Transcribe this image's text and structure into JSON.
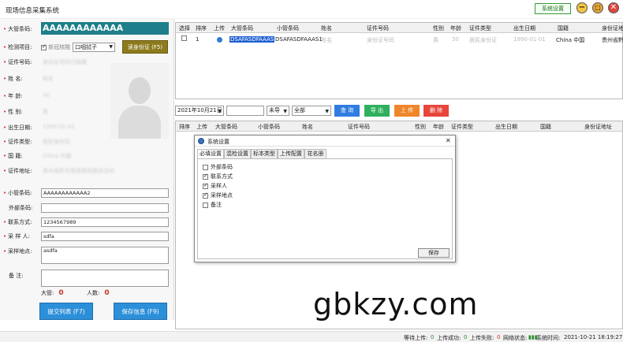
{
  "window": {
    "title": "现场信息采集系统",
    "settings_button": "系统设置",
    "min": "−",
    "max": "□",
    "close": "✕"
  },
  "form": {
    "big_barcode_label": "大管条码:",
    "big_barcode_value": "AAAAAAAAAAAA",
    "test_item_label": "检测项目:",
    "covid_checkbox_label": "新冠核酸",
    "swab_select": "口咽拭子",
    "read_card_button": "读身份证 (F5)",
    "id_no_label": "证件号码:",
    "id_no_value": "身份证号码已隐藏",
    "name_label": "姓     名:",
    "name_value": "姓名",
    "age_label": "年     龄:",
    "age_value": "30",
    "sex_label": "性     别:",
    "sex_value": "男",
    "birth_label": "出生日期:",
    "birth_value": "1990-01-01",
    "id_type_label": "证件类型:",
    "id_type_value": "居民身份证",
    "nationality_label": "国     籍:",
    "nationality_value": "China 中国",
    "address_label": "证件地址:",
    "address_value": "贵州省黔东南苗族侗族自治州",
    "small_barcode_label": "小管条码:",
    "small_barcode_value": "AAAAAAAAAAAA2",
    "external_barcode_label": "外部条码:",
    "external_barcode_value": "",
    "contact_label": "联系方式:",
    "contact_value": "1234567989",
    "sampler_label": "采 样 人:",
    "sampler_value": "sdfa",
    "sample_place_label": "采样地点:",
    "sample_place_value": "asdfa",
    "remark_label": "备     注:",
    "remark_value": "",
    "big_count_label": "大管:",
    "big_count_value": "0",
    "people_count_label": "人数:",
    "people_count_value": "0",
    "submit_button": "提交列表 (F7)",
    "save_button": "保存信息 (F9)"
  },
  "upper_table": {
    "headers": [
      "选择",
      "排序",
      "上传",
      "大管条码",
      "小管条码",
      "姓名",
      "证件号码",
      "性别",
      "年龄",
      "证件类型",
      "出生日期",
      "国籍",
      "身份证地"
    ],
    "rows": [
      {
        "seq": "1",
        "big": "DSAFASDFAAAS",
        "small": "DSAFASDFAAAS1",
        "name": "姓名",
        "id": "身份证号码",
        "sex": "男",
        "age": "30",
        "type": "居民身份证",
        "birth": "1990-01-01",
        "nation": "China 中国",
        "addr": "贵州省黔..."
      }
    ]
  },
  "toolbar": {
    "date": "2021年10月21日",
    "search_value": "",
    "status_select": "未导",
    "scope_select": "全部",
    "query": "查 询",
    "export": "导 出",
    "upload": "上 传",
    "delete": "删 除"
  },
  "lower_table": {
    "headers": [
      "排序",
      "上传",
      "大管条码",
      "小管条码",
      "姓名",
      "证件号码",
      "性别",
      "年龄",
      "证件类型",
      "出生日期",
      "国籍",
      "身份证地址"
    ]
  },
  "dialog": {
    "title": "系统设置",
    "close": "✕",
    "tabs": [
      "必填设置",
      "混检设置",
      "标本类型",
      "上传配置",
      "花名册"
    ],
    "options": [
      {
        "label": "外部条码",
        "checked": false
      },
      {
        "label": "联系方式",
        "checked": true
      },
      {
        "label": "采样人",
        "checked": true
      },
      {
        "label": "采样地点",
        "checked": true
      },
      {
        "label": "备注",
        "checked": false
      }
    ],
    "save": "保存"
  },
  "watermark": "gbkzy.com",
  "status": {
    "waiting_label": "等待上传:",
    "waiting_value": "0",
    "success_label": "上传成功:",
    "success_value": "0",
    "fail_label": "上传失败:",
    "fail_value": "0",
    "network_label": "网络状态:",
    "system_time_label": "系统时间:",
    "system_time_value": "2021-10-21 18:19:27"
  }
}
